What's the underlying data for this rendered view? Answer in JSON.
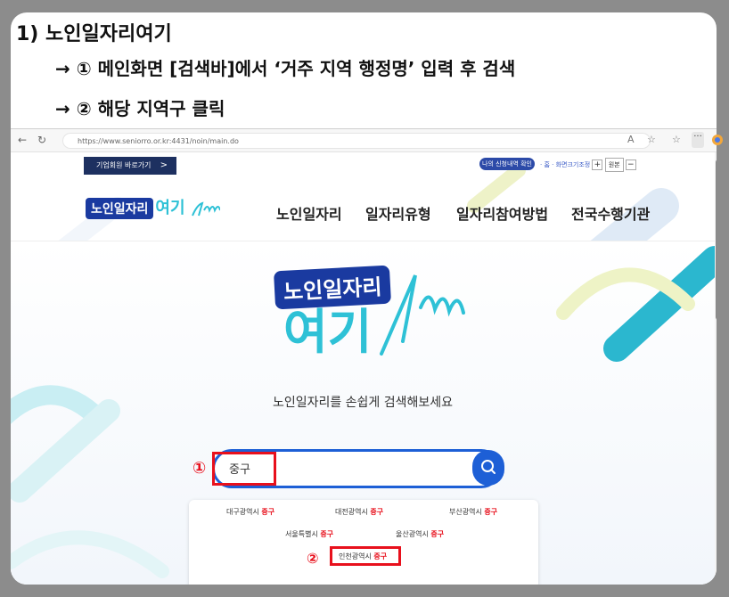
{
  "instructions": {
    "heading": "1) 노인일자리여기",
    "step1": "→ ① 메인화면 [검색바]에서 ‘거주 지역 행정명’ 입력 후 검색",
    "step2": "→ ② 해당 지역구 클릭"
  },
  "browser": {
    "url": "https://www.seniorro.or.kr:4431/noin/main.do",
    "nav_icons": [
      "back-icon",
      "refresh-icon"
    ],
    "toolbar_icons": [
      "read-aloud-icon",
      "favorite-icon",
      "collections-icon",
      "more-icon",
      "copilot-icon"
    ]
  },
  "site": {
    "utility": {
      "org_button": "기업회원 바로가기",
      "my_info": "나의 신청내역 확인",
      "links": "· 홈 · 화면크기조정",
      "zoom_plus": "+",
      "zoom_reset": "원본",
      "zoom_minus": "−"
    },
    "logo": {
      "text_main": "노인일자리",
      "text_accent": "여기"
    },
    "nav": [
      "노인일자리",
      "일자리유형",
      "일자리참여방법",
      "전국수행기관"
    ],
    "hero": {
      "logo_line1": "노인일자리",
      "logo_line2": "여기",
      "tagline": "노인일자리를 손쉽게 검색해보세요"
    },
    "search": {
      "value": "중구",
      "marker": "①"
    },
    "suggestions": [
      {
        "city": "대구광역시",
        "district": "중구"
      },
      {
        "city": "대전광역시",
        "district": "중구"
      },
      {
        "city": "부산광역시",
        "district": "중구"
      },
      {
        "city": "서울특별시",
        "district": "중구"
      },
      {
        "city": "울산광역시",
        "district": "중구"
      },
      {
        "city": "인천광역시",
        "district": "중구"
      }
    ],
    "suggestion_marker": "②"
  },
  "colors": {
    "accent_blue": "#1d5fd6",
    "navy": "#1d3060",
    "highlight_red": "#e8101c",
    "teal": "#2ec1d6"
  }
}
